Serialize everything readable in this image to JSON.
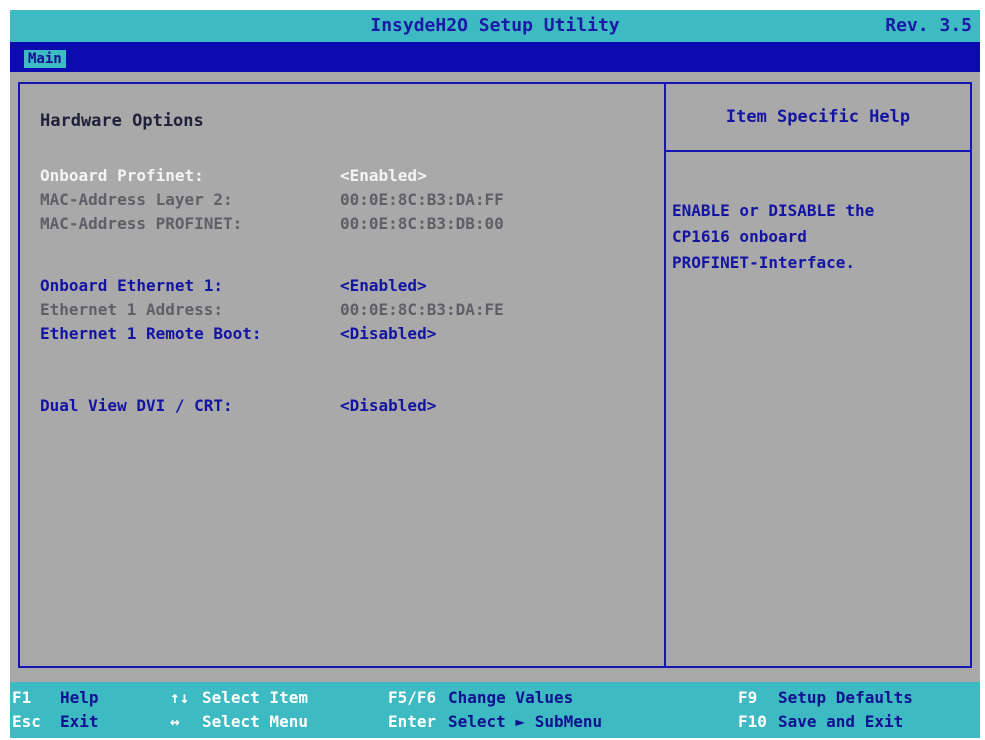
{
  "window": {
    "title": "InsydeH2O Setup Utility",
    "revision": "Rev. 3.5"
  },
  "menu": {
    "tabs": [
      {
        "label": "Main",
        "active": true
      }
    ]
  },
  "main": {
    "heading": "Hardware Options",
    "settings": [
      {
        "label": "Onboard Profinet:",
        "value": "<Enabled>",
        "state": "selected"
      },
      {
        "label": "MAC-Address Layer 2:",
        "value": "00:0E:8C:B3:DA:FF",
        "state": "readonly"
      },
      {
        "label": "MAC-Address PROFINET:",
        "value": "00:0E:8C:B3:DB:00",
        "state": "readonly"
      },
      {
        "label": "Onboard Ethernet 1:",
        "value": "<Enabled>",
        "state": "active"
      },
      {
        "label": "Ethernet 1 Address:",
        "value": "00:0E:8C:B3:DA:FE",
        "state": "readonly"
      },
      {
        "label": "Ethernet 1 Remote Boot:",
        "value": "<Disabled>",
        "state": "active"
      },
      {
        "label": "Dual View DVI / CRT:",
        "value": "<Disabled>",
        "state": "active"
      }
    ]
  },
  "help": {
    "title": "Item Specific Help",
    "lines": [
      "ENABLE or DISABLE the",
      "CP1616 onboard",
      "PROFINET-Interface."
    ]
  },
  "footer": {
    "items": [
      {
        "key": "F1",
        "action": "Help"
      },
      {
        "key": "↑↓",
        "action": "Select Item"
      },
      {
        "key": "F5/F6",
        "action": "Change Values"
      },
      {
        "key": "F9",
        "action": "Setup Defaults"
      },
      {
        "key": "Esc",
        "action": "Exit"
      },
      {
        "key": "↔",
        "action": "Select Menu"
      },
      {
        "key": "Enter",
        "action": "Select ► SubMenu"
      },
      {
        "key": "F10",
        "action": "Save and Exit"
      }
    ]
  },
  "colors": {
    "background": "#a9a9a9",
    "title_bar": "#3dbac2",
    "menu_bar": "#0b0bb0",
    "accent_text": "#1414a2",
    "selected_text": "#f4f4f4",
    "readonly_text": "#5f5f66"
  }
}
